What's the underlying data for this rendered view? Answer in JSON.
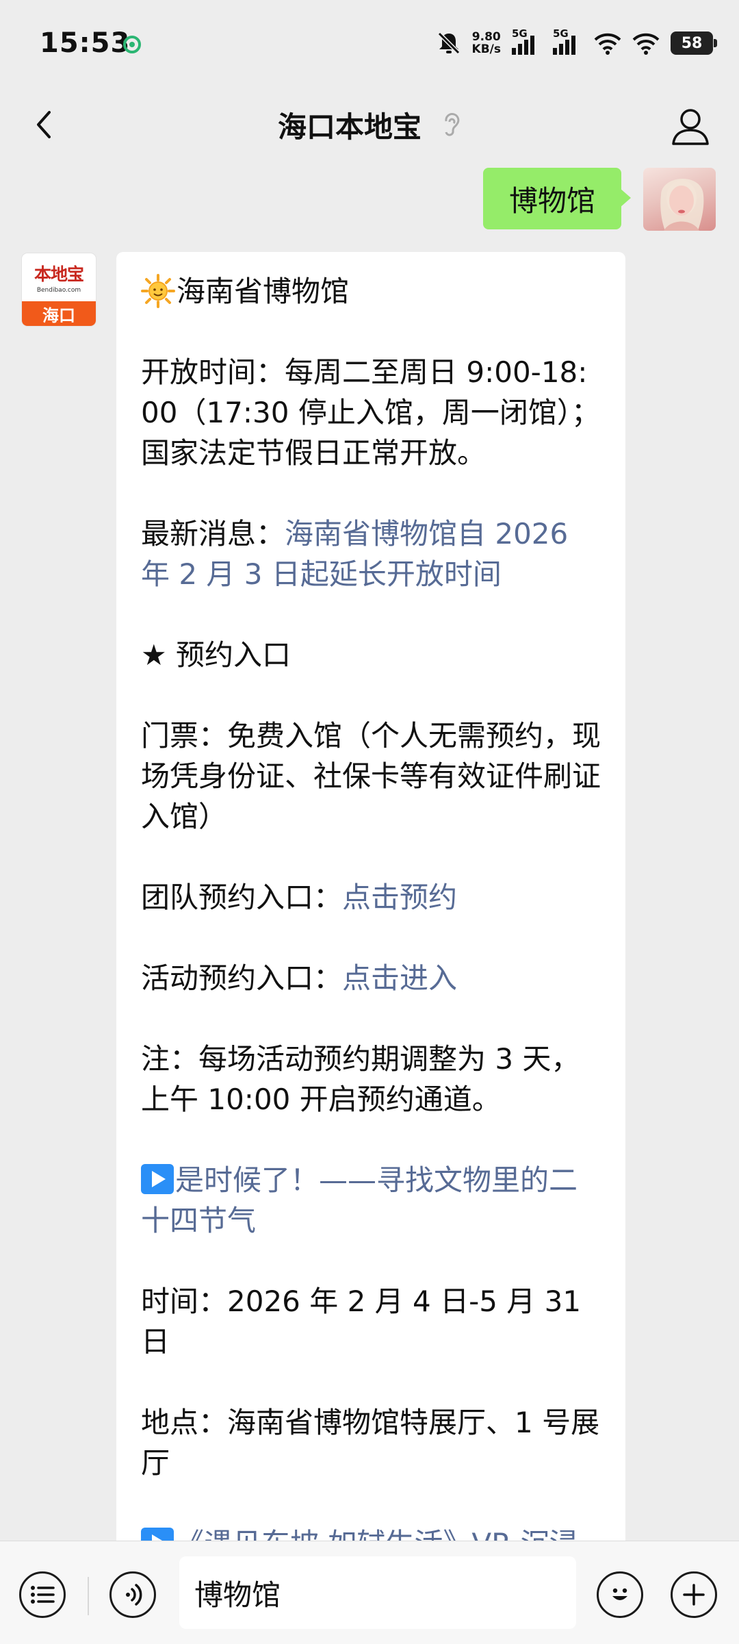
{
  "status_bar": {
    "time": "15:53",
    "net_speed_value": "9.80",
    "net_speed_unit": "KB/s",
    "signal_1_label": "5G",
    "signal_2_label": "5G",
    "battery": "58"
  },
  "header": {
    "title": "海口本地宝",
    "back_icon": "chevron-left-icon",
    "profile_icon": "person-icon",
    "ear_icon": "ear-icon"
  },
  "user_message": {
    "text": "博物馆"
  },
  "bot_avatar": {
    "logo_cn": "本地宝",
    "logo_en": "Bendibao.com",
    "city": "海口"
  },
  "bot_message": {
    "title": "海南省博物馆",
    "hours": "开放时间：每周二至周日 9:00-18:00（17:30 停止入馆，周一闭馆）；国家法定节假日正常开放。",
    "news_label": "最新消息：",
    "news_link": "海南省博物馆自 2026 年 2 月 3 日起延长开放时间",
    "reserve_heading": "★ 预约入口",
    "tickets": "门票：免费入馆（个人无需预约，现场凭身份证、社保卡等有效证件刷证入馆）",
    "group_label": "团队预约入口：",
    "group_link": "点击预约",
    "activity_label": "活动预约入口：",
    "activity_link": "点击进入",
    "note": "注：每场活动预约期调整为 3 天，上午 10:00 开启预约通道。",
    "exhibit1_link": "是时候了！——寻找文物里的二十四节气",
    "exhibit1_time": "时间：2026 年 2 月 4 日-5 月 31 日",
    "exhibit1_place": "地点：海南省博物馆特展厅、1 号展厅",
    "exhibit2_link": "《遇见东坡·如轼生活》VR 沉浸娱乐展"
  },
  "input_bar": {
    "value": "博物馆",
    "menu_icon": "list-menu-icon",
    "voice_icon": "voice-icon",
    "emoji_icon": "emoji-icon",
    "plus_icon": "plus-icon"
  },
  "colors": {
    "background": "#ededed",
    "user_bubble": "#95ec69",
    "link": "#576b95",
    "brand_orange": "#f15a1a"
  }
}
